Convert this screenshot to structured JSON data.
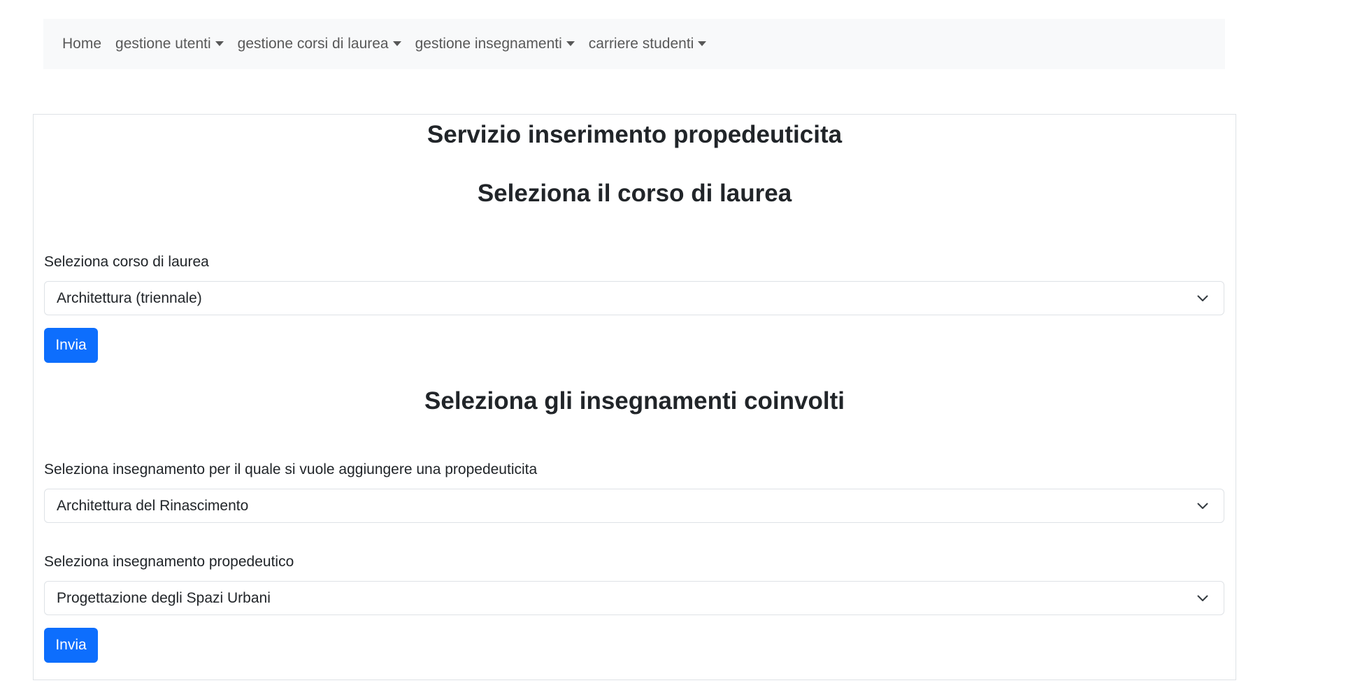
{
  "navbar": {
    "items": [
      {
        "label": "Home",
        "dropdown": false
      },
      {
        "label": "gestione utenti",
        "dropdown": true
      },
      {
        "label": "gestione corsi di laurea",
        "dropdown": true
      },
      {
        "label": "gestione insegnamenti",
        "dropdown": true
      },
      {
        "label": "carriere studenti",
        "dropdown": true
      }
    ]
  },
  "page": {
    "title": "Servizio inserimento propedeuticita",
    "section1": {
      "heading": "Seleziona il corso di laurea",
      "field_label": "Seleziona corso di laurea",
      "selected_value": "Architettura (triennale)",
      "submit_label": "Invia"
    },
    "section2": {
      "heading": "Seleziona gli insegnamenti coinvolti",
      "field1_label": "Seleziona insegnamento per il quale si vuole aggiungere una propedeuticita",
      "field1_value": "Architettura del Rinascimento",
      "field2_label": "Seleziona insegnamento propedeutico",
      "field2_value": "Progettazione degli Spazi Urbani",
      "submit_label": "Invia"
    }
  },
  "colors": {
    "navbar_bg": "#f8f9fa",
    "primary_button": "#0d6efd",
    "border": "#dee2e6"
  },
  "icons": {
    "select_arrow": "chevron-down-icon",
    "nav_dropdown": "caret-down-icon"
  }
}
